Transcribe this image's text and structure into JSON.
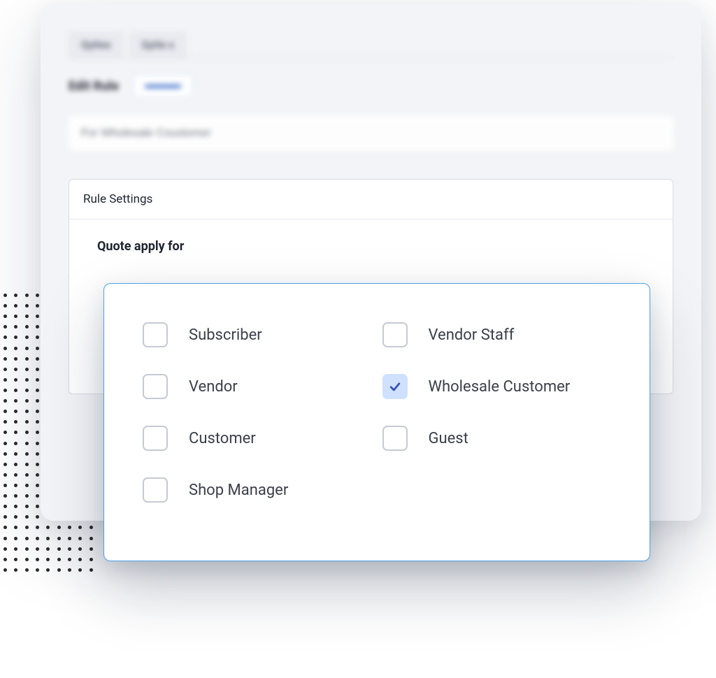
{
  "tabs": {
    "a": "Qyites",
    "b": "Qyite s"
  },
  "edit": {
    "label": "Edit Rule"
  },
  "rule_name_input": {
    "value": "For Wholesale Coustomer"
  },
  "settings": {
    "header": "Rule Settings",
    "apply_label": "Quote apply for"
  },
  "options": {
    "subscriber": {
      "label": "Subscriber",
      "checked": false
    },
    "vendor": {
      "label": "Vendor",
      "checked": false
    },
    "customer": {
      "label": "Customer",
      "checked": false
    },
    "shop_manager": {
      "label": "Shop Manager",
      "checked": false
    },
    "vendor_staff": {
      "label": "Vendor Staff",
      "checked": false
    },
    "wholesale": {
      "label": "Wholesale Customer",
      "checked": true
    },
    "guest": {
      "label": "Guest",
      "checked": false
    }
  }
}
